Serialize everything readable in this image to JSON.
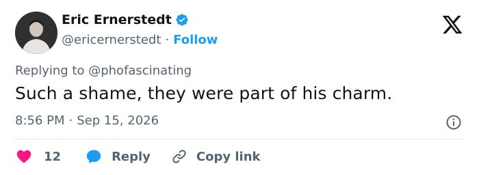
{
  "author": {
    "name": "Eric Ernerstedt",
    "handle": "@ericernerstedt",
    "separator": "·",
    "follow_label": "Follow"
  },
  "reply_context": {
    "prefix": "Replying to",
    "mention": "@phofascinating"
  },
  "tweet": {
    "text": "Such a shame, they were part of his charm.",
    "time": "8:56 PM",
    "separator": "·",
    "date": "Sep 15, 2026"
  },
  "actions": {
    "like_count": "12",
    "reply_label": "Reply",
    "copy_label": "Copy link"
  },
  "colors": {
    "accent": "#1d9bf0",
    "like": "#f91880",
    "muted": "#536471",
    "text": "#0f1419"
  },
  "icons": {
    "logo": "x-logo-icon",
    "verified": "verified-badge-icon",
    "info": "info-icon",
    "like": "heart-icon",
    "reply": "speech-bubble-icon",
    "copy": "link-icon"
  }
}
